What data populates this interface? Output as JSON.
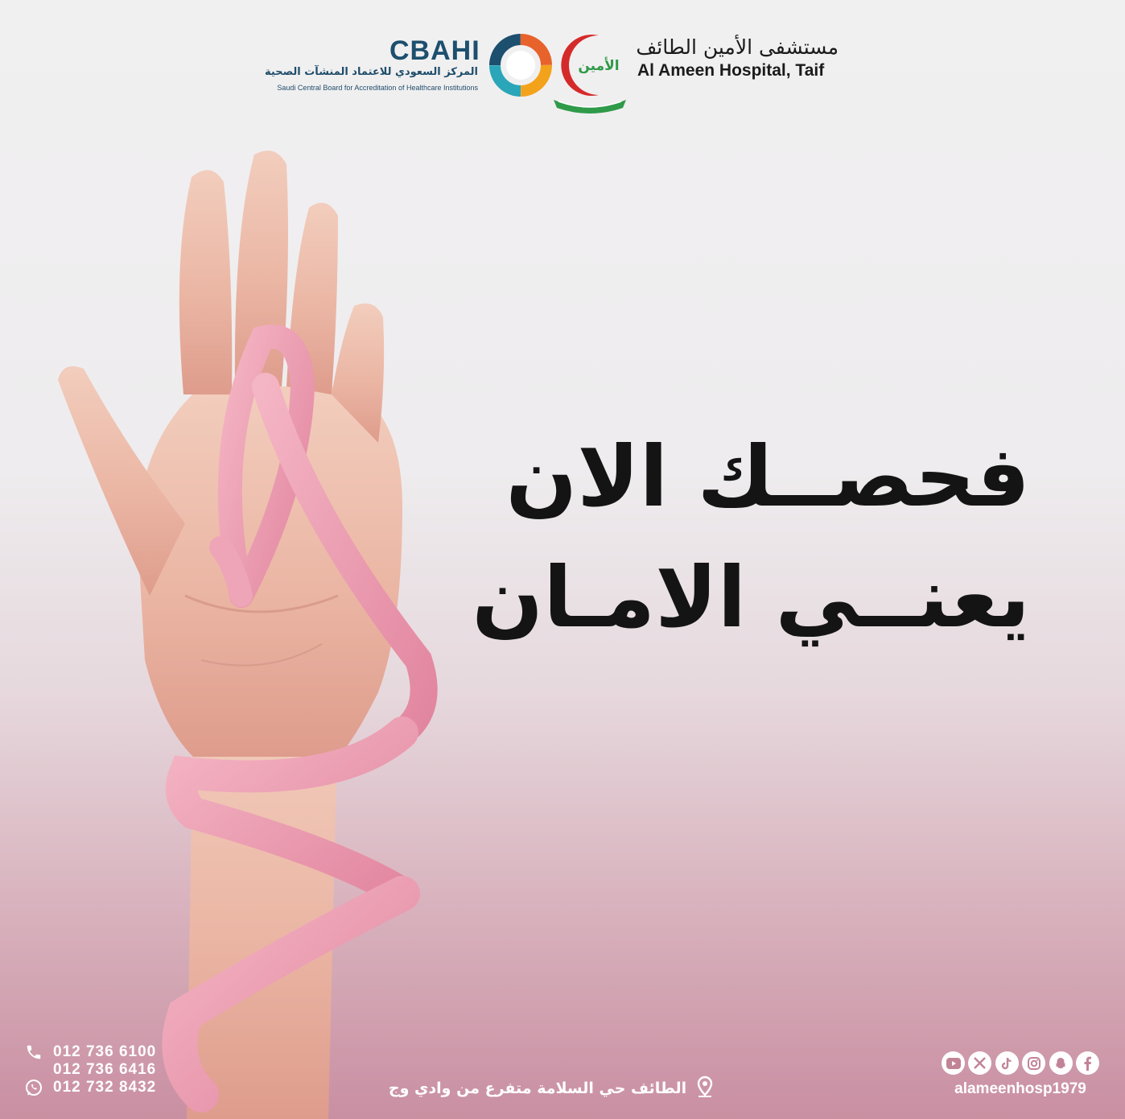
{
  "header": {
    "cbahi_title": "CBAHI",
    "cbahi_subtitle_ar": "المركز السعودي للاعتماد المنشآت الصحية",
    "cbahi_subtitle_en": "Saudi Central Board for Accreditation of Healthcare Institutions",
    "hospital_name_ar": "مستشفى الأمين الطائف",
    "hospital_name_en": "Al Ameen Hospital, Taif",
    "emblem_label": "الأمين"
  },
  "headline": {
    "line1": "فحصــك الان",
    "line2": "يعنــي الامـان"
  },
  "footer": {
    "phones": [
      "012 736 6100",
      "012 736 6416",
      "012 732 8432"
    ],
    "address": "الطائف حي السلامة متفرع من وادي وج",
    "social_handle": "alameenhosp1979",
    "social_icons": [
      "youtube-icon",
      "x-icon",
      "tiktok-icon",
      "instagram-icon",
      "snapchat-icon",
      "facebook-icon"
    ]
  },
  "colors": {
    "ribbon_pink": "#e99aaf",
    "cbahi_blue": "#1d4f6e",
    "ameen_red": "#d52a2a",
    "ameen_green": "#2f9a48",
    "footer_pink": "#c98fa2"
  }
}
